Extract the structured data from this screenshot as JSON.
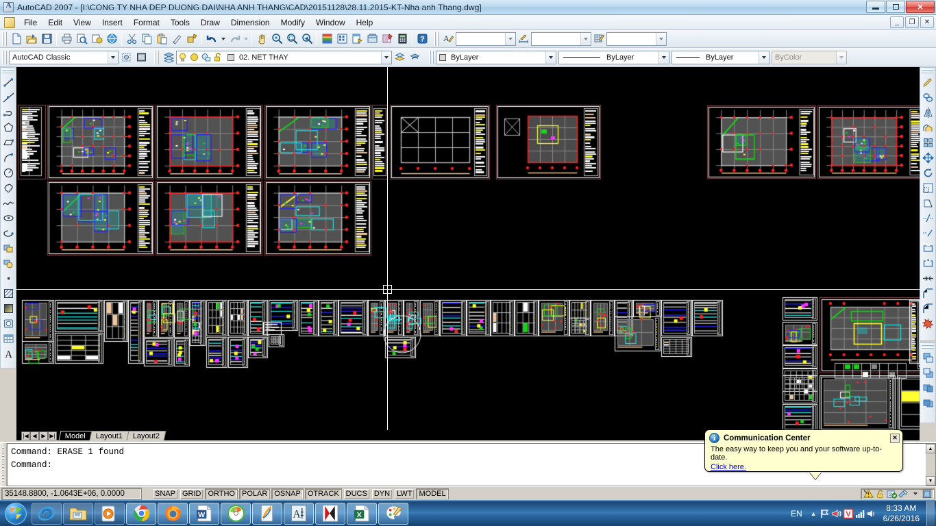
{
  "window": {
    "title": "AutoCAD 2007 - [I:\\CONG TY NHA DEP DUONG DAI\\NHA ANH THANG\\CAD\\20151128\\28.11.2015-KT-Nha anh Thang.dwg]",
    "app_icon": "autocad-logo-icon",
    "buttons": {
      "minimize": "minimize-icon",
      "maximize": "maximize-icon",
      "close": "close-icon"
    },
    "mdi_buttons": {
      "minimize": "mdi-minimize-icon",
      "restore": "mdi-restore-icon",
      "close": "mdi-close-icon"
    }
  },
  "menu": {
    "items": [
      {
        "label": "File"
      },
      {
        "label": "Edit"
      },
      {
        "label": "View"
      },
      {
        "label": "Insert"
      },
      {
        "label": "Format"
      },
      {
        "label": "Tools"
      },
      {
        "label": "Draw"
      },
      {
        "label": "Dimension"
      },
      {
        "label": "Modify"
      },
      {
        "label": "Window"
      },
      {
        "label": "Help"
      }
    ]
  },
  "standard_toolbar": {
    "icons": [
      "new-icon",
      "open-icon",
      "save-icon",
      "plot-icon",
      "plot-preview-icon",
      "publish-icon",
      "web-icon",
      "cut-icon",
      "copy-icon",
      "paste-icon",
      "match-properties-icon",
      "block-editor-icon",
      "undo-icon",
      "undo-dropdown-icon",
      "redo-icon",
      "redo-dropdown-icon",
      "pan-realtime-icon",
      "zoom-realtime-icon",
      "zoom-window-icon",
      "zoom-previous-icon",
      "properties-icon",
      "design-center-icon",
      "tool-palettes-icon",
      "sheet-set-manager-icon",
      "markup-set-manager-icon",
      "quickcalc-icon",
      "help-icon"
    ]
  },
  "styles_toolbar": {
    "text_style_icon": "text-style-icon",
    "text_style_value": "",
    "dim_style_icon": "dimension-style-icon",
    "dim_style_value": "",
    "table_style_icon": "table-style-icon",
    "table_style_value": ""
  },
  "workspaces": {
    "current": "AutoCAD Classic",
    "settings_icon": "workspace-settings-icon",
    "my_workspace_icon": "my-workspace-icon"
  },
  "layers": {
    "layer_properties_icon": "layer-properties-manager-icon",
    "current_layer": "02. NET THAY",
    "state_icons": [
      "lightbulb-on-icon",
      "sun-thaw-icon",
      "freeze-viewport-icon",
      "unlock-icon",
      "layer-color-swatch"
    ],
    "layer_previous_icon": "layer-previous-icon",
    "make_current_icon": "make-object-layer-current-icon"
  },
  "properties": {
    "color": "ByLayer",
    "linetype": "ByLayer",
    "lineweight": "ByLayer",
    "plot_style": "ByColor",
    "plot_style_disabled": true
  },
  "draw_toolbar": {
    "title": "Draw",
    "items": [
      "line-icon",
      "construction-line-icon",
      "polyline-icon",
      "polygon-icon",
      "rectangle-icon",
      "arc-icon",
      "circle-icon",
      "revision-cloud-icon",
      "spline-icon",
      "ellipse-icon",
      "ellipse-arc-icon",
      "insert-block-icon",
      "make-block-icon",
      "point-icon",
      "hatch-icon",
      "gradient-icon",
      "region-icon",
      "table-icon",
      "multiline-text-icon"
    ]
  },
  "modify_toolbar": {
    "title": "Modify",
    "items": [
      "erase-icon",
      "copy-object-icon",
      "mirror-icon",
      "offset-icon",
      "array-icon",
      "move-icon",
      "rotate-icon",
      "scale-icon",
      "stretch-icon",
      "trim-icon",
      "extend-icon",
      "break-icon",
      "break-at-point-icon",
      "join-icon",
      "chamfer-icon",
      "fillet-icon",
      "explode-icon"
    ]
  },
  "draworder_toolbar": {
    "title": "Draw Order",
    "items": [
      "bring-to-front-icon",
      "send-to-back-icon",
      "bring-above-object-icon",
      "send-under-object-icon"
    ]
  },
  "layout_tabs": {
    "nav_buttons": [
      "first-tab-icon",
      "previous-tab-icon",
      "next-tab-icon",
      "last-tab-icon"
    ],
    "tabs": [
      {
        "label": "Model",
        "active": true
      },
      {
        "label": "Layout1",
        "active": false
      },
      {
        "label": "Layout2",
        "active": false
      }
    ]
  },
  "command_window": {
    "lines": [
      "Command:  ERASE 1 found",
      "Command:"
    ],
    "scroll_up_icon": "scroll-up-icon",
    "scroll_down_icon": "scroll-down-icon"
  },
  "status_bar": {
    "coordinates": "35148.8800, -1.0643E+06, 0.0000",
    "toggles": [
      {
        "label": "SNAP",
        "on": false
      },
      {
        "label": "GRID",
        "on": false
      },
      {
        "label": "ORTHO",
        "on": true
      },
      {
        "label": "POLAR",
        "on": true
      },
      {
        "label": "OSNAP",
        "on": true
      },
      {
        "label": "OTRACK",
        "on": true
      },
      {
        "label": "DUCS",
        "on": false
      },
      {
        "label": "DYN",
        "on": false
      },
      {
        "label": "LWT",
        "on": false
      },
      {
        "label": "MODEL",
        "on": true
      }
    ],
    "tray_icons": [
      "warning-icon",
      "unlocked-toolbars-icon",
      "communication-center-icon",
      "manage-xrefs-icon",
      "tray-options-icon",
      "clean-screen-icon"
    ]
  },
  "balloon": {
    "icon": "info-icon",
    "title": "Communication Center",
    "body": "The easy way to keep you and your software up-to-date.",
    "link": "Click here.",
    "close_icon": "close-icon"
  },
  "taskbar": {
    "start_icon": "windows-start-orb-icon",
    "items": [
      {
        "name": "internet-explorer-icon",
        "state": "pinned"
      },
      {
        "name": "windows-explorer-icon",
        "state": "pinned"
      },
      {
        "name": "media-player-icon",
        "state": "pinned"
      },
      {
        "name": "google-chrome-icon",
        "state": "active"
      },
      {
        "name": "mozilla-firefox-icon",
        "state": "active"
      },
      {
        "name": "microsoft-word-icon",
        "state": "active"
      },
      {
        "name": "nero-icon",
        "state": "active"
      },
      {
        "name": "foxit-reader-icon",
        "state": "active"
      },
      {
        "name": "autocad-icon",
        "state": "active"
      },
      {
        "name": "kaspersky-icon",
        "state": "active"
      },
      {
        "name": "microsoft-excel-icon",
        "state": "active"
      },
      {
        "name": "paint-icon",
        "state": "active"
      }
    ],
    "tray": {
      "language": "EN",
      "show_hidden_icon": "show-hidden-icons-icon",
      "icons": [
        "network-flag-icon",
        "volume-icon",
        "unikey-icon",
        "signal-bars-icon",
        "speaker-icon"
      ],
      "time": "8:33 AM",
      "date": "6/26/2016"
    }
  },
  "colors": {
    "canvas_bg": "#000000",
    "crosshair": "#ffffff",
    "title_accent": "#a8cce8",
    "taskbar": "#2e6ba5",
    "balloon_bg": "#ffffd0",
    "link": "#0000cc"
  }
}
